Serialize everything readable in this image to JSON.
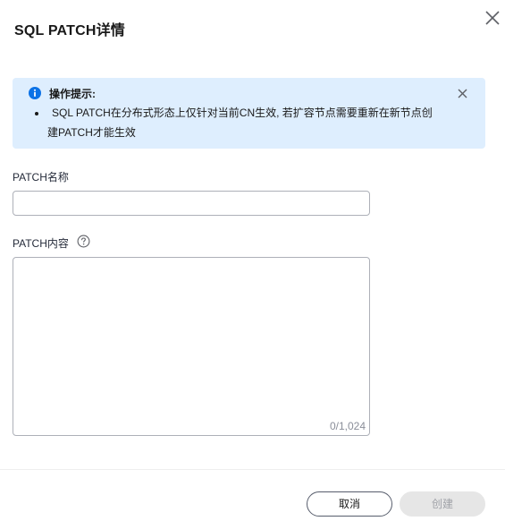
{
  "dialog": {
    "title": "SQL PATCH详情",
    "close_icon": "close-icon"
  },
  "notice": {
    "icon": "info-icon",
    "title": "操作提示:",
    "text_line1": "SQL PATCH在分布式形态上仅针对当前CN生效, 若扩容节点需要重新在新节点创",
    "text_line2": "建PATCH才能生效",
    "close_icon": "close-icon",
    "colors": {
      "background": "#deeefe",
      "icon": "#0c72e6"
    }
  },
  "form": {
    "name_label": "PATCH名称",
    "name_value": "",
    "content_label": "PATCH内容",
    "content_help_icon": "question-circle-icon",
    "content_value": "",
    "content_counter": "0/1,024"
  },
  "footer": {
    "cancel_label": "取消",
    "create_label": "创建",
    "create_disabled": true
  }
}
